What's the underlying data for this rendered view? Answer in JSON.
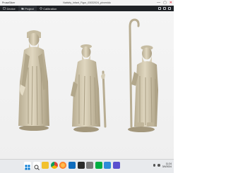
{
  "window": {
    "app_name": "PrusaSlicer",
    "document_title": "Nativity_Infant_Figur_03032024_pirvenido",
    "controls": {
      "minimize": "—",
      "maximize": "▢",
      "close": "✕"
    }
  },
  "toolbar": {
    "tabs": [
      {
        "label": "Device",
        "icon": "device-icon"
      },
      {
        "label": "Project",
        "icon": "project-icon"
      },
      {
        "label": "Calibration",
        "icon": "calibration-icon"
      }
    ]
  },
  "viewport": {
    "figures": [
      {
        "name": "elder-with-book"
      },
      {
        "name": "shepherd-with-stick"
      },
      {
        "name": "shepherd-with-crook"
      }
    ],
    "model_color": "#d2c8ae",
    "shadow_color": "#a3977c"
  },
  "taskbar": {
    "apps": [
      "windows-start",
      "search",
      "file-explorer",
      "chrome",
      "firefox",
      "mail",
      "terminal",
      "settings",
      "slicer",
      "photos",
      "store"
    ],
    "time": "11:24",
    "date": "3/4/2024"
  }
}
